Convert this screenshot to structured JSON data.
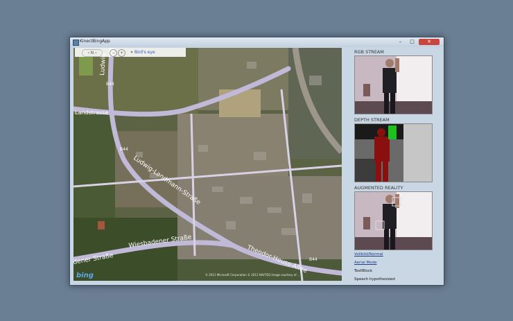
{
  "window": {
    "title": "KinectBingApp",
    "minimize": "–",
    "maximize": "□",
    "close": "✕"
  },
  "map": {
    "toolbar": {
      "compass": "‹ N ›",
      "zoom_out": "−",
      "zoom_in": "+",
      "style_arrow": "▾",
      "mode": "Bird's eye"
    },
    "labels": {
      "road_b44": "B44",
      "road_ludwig": "Ludwig",
      "road_landstrasse": "Landstrasse",
      "road_ludwig_landmann": "Ludwig-Landmann-Straße",
      "road_wiesbadener": "Wiesbadener Straße",
      "road_theodor": "Theodor-Heuss-Allee",
      "road_ner": "dener Straße"
    },
    "bing_logo": "bing",
    "copyright": "© 2011 Microsoft Corporation   © 2011 NAVTEQ   Image courtesy of ..."
  },
  "panel": {
    "rgb_label": "RGB STREAM",
    "depth_label": "DEPTH STREAM",
    "ar_label": "AUGMENTED REALITY",
    "link_normal": "Vollbild/Normal",
    "link_aerial": "Aerial Mode",
    "textblock": "TextBlock",
    "speech": "Speech hypothesized"
  }
}
